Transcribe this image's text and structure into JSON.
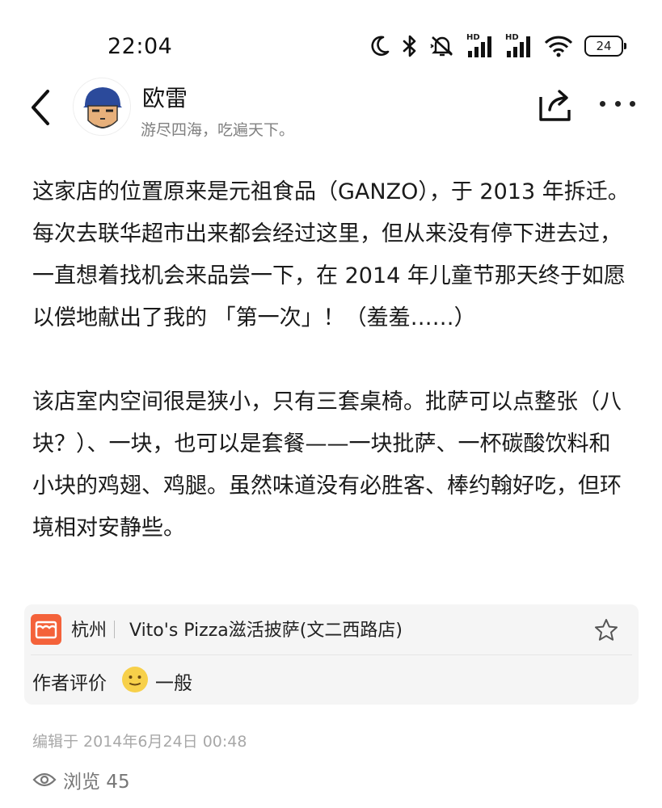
{
  "status_bar": {
    "time": "22:04",
    "icons": [
      "moon-icon",
      "bluetooth-icon",
      "mute-icon",
      "signal-hd-icon",
      "signal-hd-icon",
      "wifi-icon"
    ],
    "hd_label_1": "HD",
    "hd_label_2": "HD",
    "battery_level": "24"
  },
  "header": {
    "author_name": "欧雷",
    "author_bio": "游尽四海，吃遍天下。"
  },
  "content": {
    "paragraphs": [
      "这家店的位置原来是元祖食品（GANZO），于 2013 年拆迁。每次去联华超市出来都会经过这里，但从来没有停下进去过，一直想着找机会来品尝一下，在 2014 年儿童节那天终于如愿以偿地献出了我的 「第一次」！（羞羞……）",
      "该店室内空间很是狭小，只有三套桌椅。批萨可以点整张（八块？）、一块，也可以是套餐——一块批萨、一杯碳酸饮料和小块的鸡翅、鸡腿。虽然味道没有必胜客、棒约翰好吃，但环境相对安静些。"
    ]
  },
  "place": {
    "city": "杭州",
    "name": "Vito's Pizza滋活披萨(文二西路店)",
    "rating_label": "作者评价",
    "rating_value": "一般"
  },
  "meta": {
    "edit_time": "编辑于 2014年6月24日 00:48",
    "views": "浏览 45"
  },
  "colors": {
    "accent": "#f4623a",
    "card_bg": "#f5f5f5",
    "muted_text": "#a8a8a8"
  }
}
